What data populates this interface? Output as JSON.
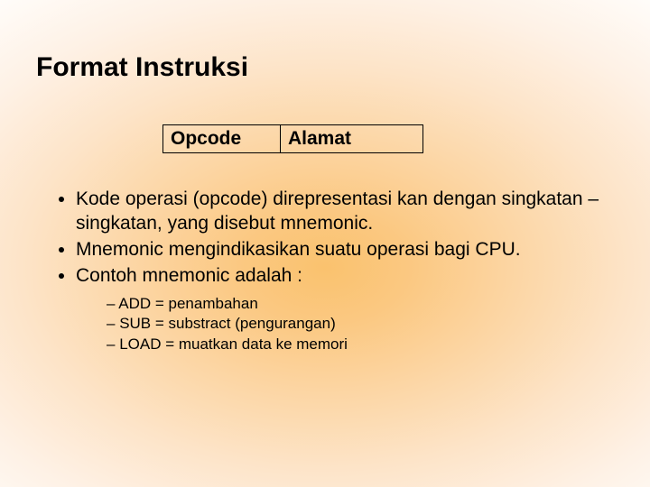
{
  "title": "Format Instruksi",
  "format": {
    "cell1": "Opcode",
    "cell2": "Alamat"
  },
  "bullets": {
    "b1": "Kode operasi (opcode) direpresentasi kan dengan singkatan – singkatan, yang disebut mnemonic.",
    "b2": "Mnemonic mengindikasikan suatu operasi bagi CPU.",
    "b3": " Contoh mnemonic adalah :"
  },
  "sub": {
    "s1": "ADD = penambahan",
    "s2": "SUB = substract (pengurangan)",
    "s3": "LOAD = muatkan data ke memori"
  }
}
